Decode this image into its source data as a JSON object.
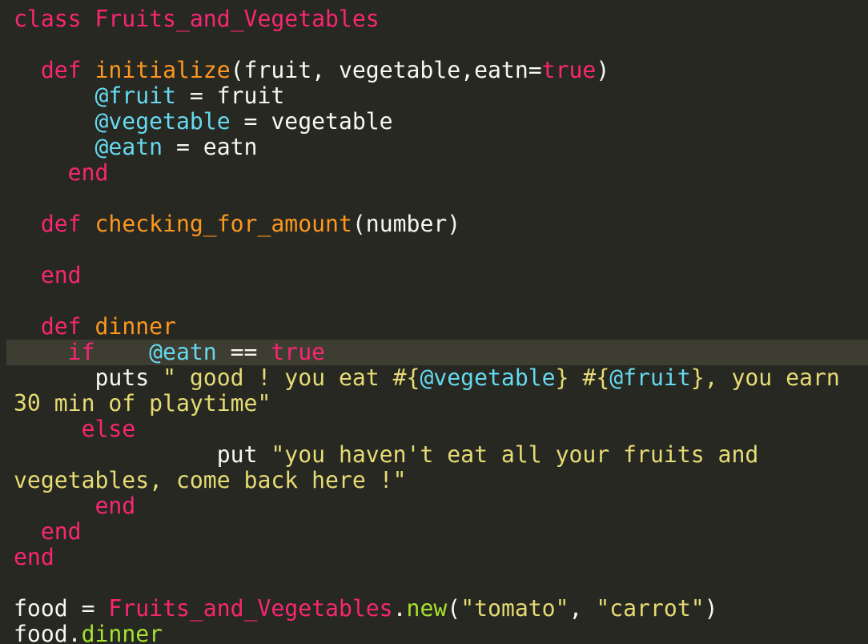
{
  "editor": {
    "lines": [
      [
        {
          "t": "class ",
          "c": "kw"
        },
        {
          "t": "Fruits_and_Vegetables",
          "c": "cls"
        }
      ],
      [],
      [
        {
          "t": "  "
        },
        {
          "t": "def",
          "c": "kw"
        },
        {
          "t": " "
        },
        {
          "t": "initialize",
          "c": "fn"
        },
        {
          "t": "(fruit, vegetable,eatn="
        },
        {
          "t": "true",
          "c": "kw"
        },
        {
          "t": ")"
        }
      ],
      [
        {
          "t": "      "
        },
        {
          "t": "@fruit",
          "c": "iv"
        },
        {
          "t": " = fruit"
        }
      ],
      [
        {
          "t": "      "
        },
        {
          "t": "@vegetable",
          "c": "iv"
        },
        {
          "t": " = vegetable"
        }
      ],
      [
        {
          "t": "      "
        },
        {
          "t": "@eatn",
          "c": "iv"
        },
        {
          "t": " = eatn"
        }
      ],
      [
        {
          "t": "    "
        },
        {
          "t": "end",
          "c": "kw"
        }
      ],
      [],
      [
        {
          "t": "  "
        },
        {
          "t": "def",
          "c": "kw"
        },
        {
          "t": " "
        },
        {
          "t": "checking_for_amount",
          "c": "fn"
        },
        {
          "t": "(number)"
        }
      ],
      [],
      [
        {
          "t": "  "
        },
        {
          "t": "end",
          "c": "kw"
        }
      ],
      [],
      [
        {
          "t": "  "
        },
        {
          "t": "def",
          "c": "kw"
        },
        {
          "t": " "
        },
        {
          "t": "dinner",
          "c": "fn"
        }
      ],
      [
        {
          "t": "    "
        },
        {
          "t": "if",
          "c": "kw"
        },
        {
          "t": "    "
        },
        {
          "t": "@eatn",
          "c": "iv"
        },
        {
          "t": " == "
        },
        {
          "t": "true",
          "c": "kw"
        }
      ],
      [
        {
          "t": "      puts "
        },
        {
          "t": "\" good ! you eat #{",
          "c": "str"
        },
        {
          "t": "@vegetable",
          "c": "iv"
        },
        {
          "t": "} #{",
          "c": "str"
        },
        {
          "t": "@fruit",
          "c": "iv"
        },
        {
          "t": "}, you earn",
          "c": "str"
        }
      ],
      [
        {
          "t": "30 min of playtime\"",
          "c": "str"
        }
      ],
      [
        {
          "t": "     "
        },
        {
          "t": "else",
          "c": "kw"
        }
      ],
      [
        {
          "t": "               put "
        },
        {
          "t": "\"you haven't eat all your fruits and",
          "c": "str"
        }
      ],
      [
        {
          "t": "vegetables, come back here !\"",
          "c": "str"
        }
      ],
      [
        {
          "t": "      "
        },
        {
          "t": "end",
          "c": "kw"
        }
      ],
      [
        {
          "t": "  "
        },
        {
          "t": "end",
          "c": "kw"
        }
      ],
      [
        {
          "t": "end",
          "c": "kw"
        }
      ],
      [],
      [
        {
          "t": "food = "
        },
        {
          "t": "Fruits_and_Vegetables",
          "c": "cls"
        },
        {
          "t": "."
        },
        {
          "t": "new",
          "c": "mtd"
        },
        {
          "t": "("
        },
        {
          "t": "\"tomato\"",
          "c": "str"
        },
        {
          "t": ", "
        },
        {
          "t": "\"carrot\"",
          "c": "str"
        },
        {
          "t": ")"
        }
      ],
      [
        {
          "t": "food."
        },
        {
          "t": "dinner",
          "c": "mtd"
        }
      ]
    ],
    "current_line": 13
  },
  "colors": {
    "background": "#272822",
    "current_line_background": "#3e3d32",
    "default_text": "#f8f8f2",
    "keyword": "#f92672",
    "function_name": "#fd971f",
    "instance_variable": "#66d9ef",
    "string": "#e6db74",
    "method_call": "#a6e22e"
  }
}
